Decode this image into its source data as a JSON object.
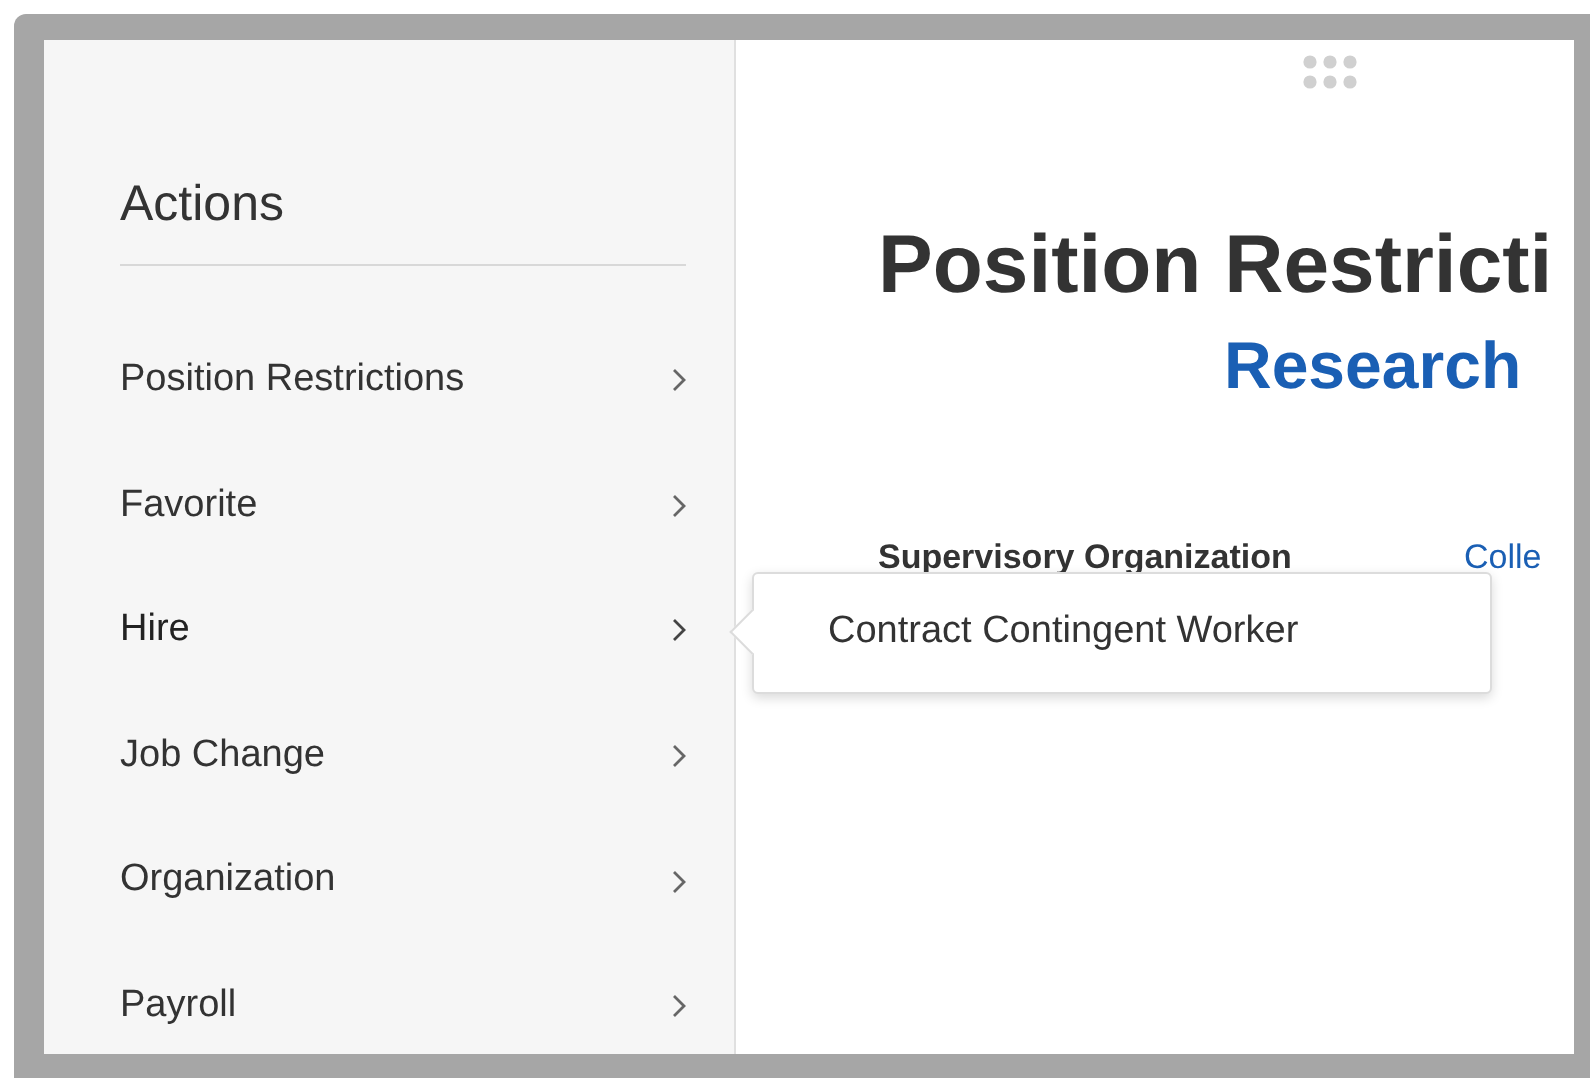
{
  "sidebar": {
    "title": "Actions",
    "items": [
      {
        "label": "Position Restrictions",
        "expanded": false
      },
      {
        "label": "Favorite",
        "expanded": false
      },
      {
        "label": "Hire",
        "expanded": true
      },
      {
        "label": "Job Change",
        "expanded": false
      },
      {
        "label": "Organization",
        "expanded": false
      },
      {
        "label": "Payroll",
        "expanded": false
      }
    ]
  },
  "submenu": {
    "items": [
      "Contract Contingent Worker"
    ]
  },
  "main": {
    "title": "Position Restricti",
    "subtitle": "Research",
    "fields": [
      {
        "label": "Supervisory Organization",
        "value": "Colle"
      }
    ]
  }
}
